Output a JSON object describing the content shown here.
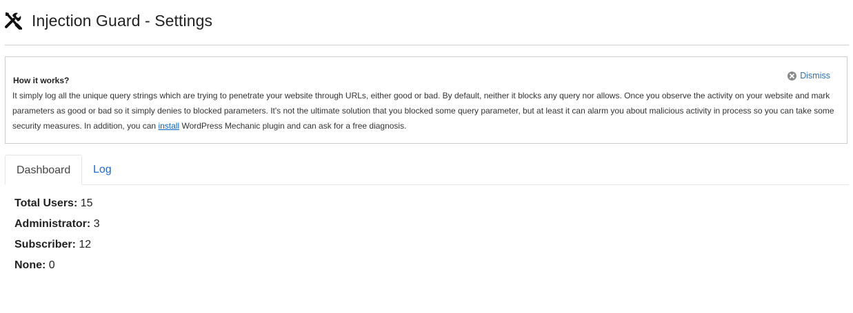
{
  "header": {
    "icon": "tools-icon",
    "title": "Injection Guard - Settings"
  },
  "notice": {
    "heading": "How it works?",
    "body_before_link": "It simply log all the unique query strings which are trying to penetrate your website through URLs, either good or bad. By default, neither it blocks any query nor allows. Once you observe the activity on your website and mark parameters as good or bad so it simply denies to blocked parameters. It's not the ultimate solution that you blocked some query parameter, but at least it can alarm you about malicious activity in process so you can take some security measures. In addition, you can ",
    "link_text": "install",
    "body_after_link": " WordPress Mechanic plugin and can ask for a free diagnosis.",
    "dismiss_label": "Dismiss",
    "dismiss_icon": "close-circle-icon"
  },
  "tabs": [
    {
      "label": "Dashboard",
      "active": true
    },
    {
      "label": "Log",
      "active": false
    }
  ],
  "stats": [
    {
      "label": "Total Users:",
      "value": "15"
    },
    {
      "label": "Administrator:",
      "value": "3"
    },
    {
      "label": "Subscriber:",
      "value": "12"
    },
    {
      "label": "None:",
      "value": "0"
    }
  ],
  "colors": {
    "link": "#1a6bd6",
    "dismiss": "#2f6fb5",
    "border": "#cccccc"
  }
}
